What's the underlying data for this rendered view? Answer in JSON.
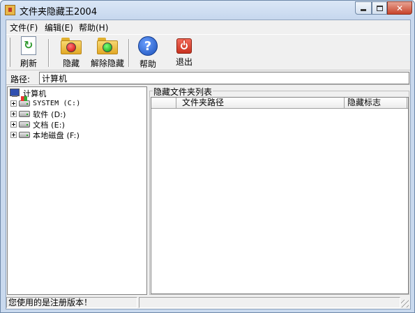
{
  "window": {
    "title": "文件夹隐藏王2004",
    "icon": "app-folder-icon"
  },
  "menu": {
    "file": "文件(F)",
    "edit": "编辑(E)",
    "help": "帮助(H)"
  },
  "toolbar": {
    "refresh": "刷新",
    "hide": "隐藏",
    "unhide": "解除隐藏",
    "help": "帮助",
    "exit": "退出"
  },
  "path": {
    "label": "路径:",
    "value": "计算机"
  },
  "tree": {
    "root": "计算机",
    "items": [
      "SYSTEM (C:)",
      "软件 (D:)",
      "文档 (E:)",
      "本地磁盘 (F:)"
    ]
  },
  "list": {
    "group_title": "隐藏文件夹列表",
    "columns": [
      "",
      "文件夹路径",
      "隐藏标志"
    ]
  },
  "status": {
    "message": "您使用的是注册版本！",
    "secondary": ""
  },
  "colors": {
    "frame": "#c9d9ee",
    "close_button": "#c7442b",
    "client_bg": "#f0f0f0"
  }
}
